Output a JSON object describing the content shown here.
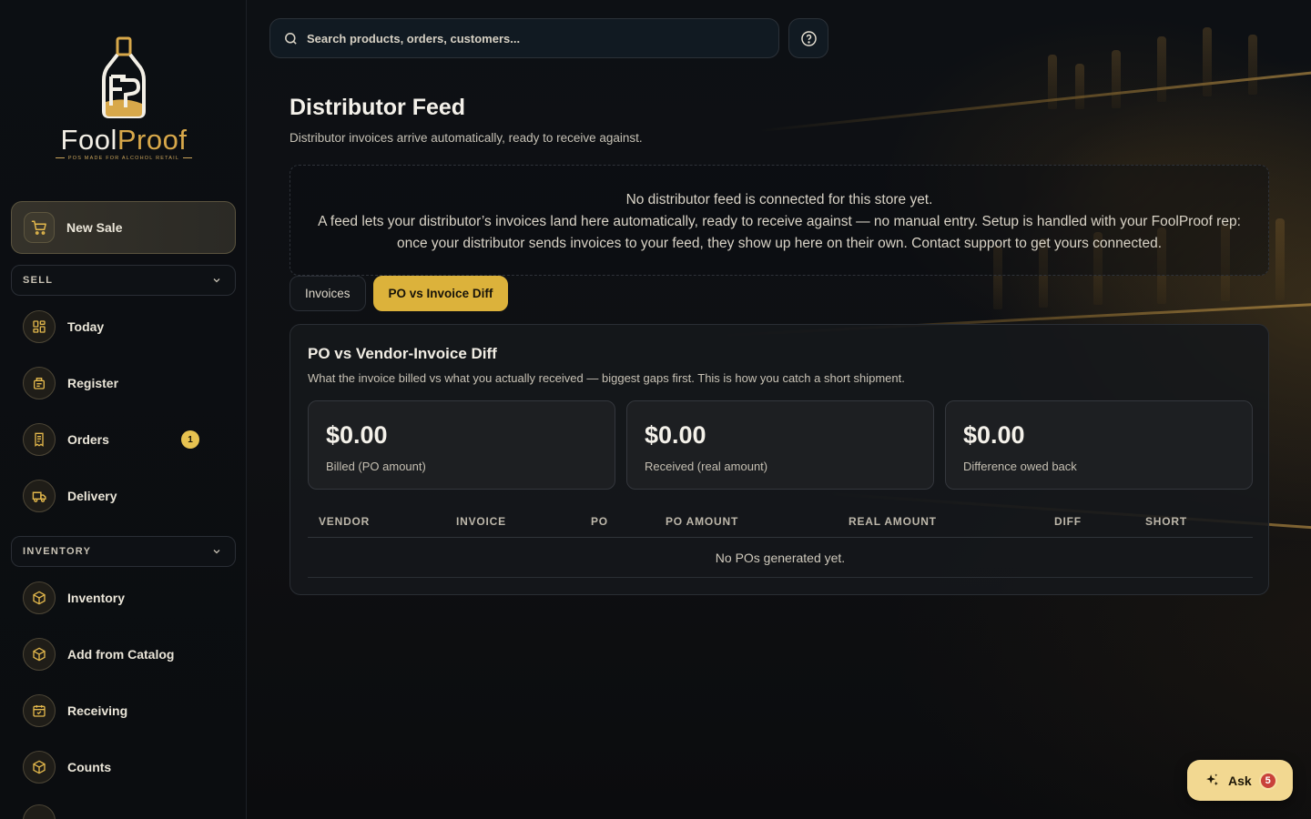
{
  "brand": {
    "name_part1": "Fool",
    "name_part2": "Proof",
    "tagline": "POS MADE FOR ALCOHOL RETAIL"
  },
  "sidebar": {
    "new_sale": "New Sale",
    "sections": [
      {
        "label": "SELL",
        "items": [
          {
            "label": "Today",
            "icon": "dashboard-icon"
          },
          {
            "label": "Register",
            "icon": "register-icon"
          },
          {
            "label": "Orders",
            "icon": "receipt-icon",
            "badge": "1"
          },
          {
            "label": "Delivery",
            "icon": "truck-icon"
          }
        ]
      },
      {
        "label": "INVENTORY",
        "items": [
          {
            "label": "Inventory",
            "icon": "box-icon"
          },
          {
            "label": "Add from Catalog",
            "icon": "box-icon"
          },
          {
            "label": "Receiving",
            "icon": "calendar-check-icon"
          },
          {
            "label": "Counts",
            "icon": "box-icon"
          }
        ]
      }
    ]
  },
  "search": {
    "placeholder": "Search products, orders, customers..."
  },
  "page": {
    "title": "Distributor Feed",
    "subtitle": "Distributor invoices arrive automatically, ready to receive against."
  },
  "notice": {
    "line1": "No distributor feed is connected for this store yet.",
    "line2": "A feed lets your distributor’s invoices land here automatically, ready to receive against — no manual entry. Setup is handled with your FoolProof rep: once your distributor sends invoices to your feed, they show up here on their own. Contact support to get yours connected."
  },
  "tabs": [
    {
      "label": "Invoices",
      "active": false
    },
    {
      "label": "PO vs Invoice Diff",
      "active": true
    }
  ],
  "diff_panel": {
    "title": "PO vs Vendor-Invoice Diff",
    "subtitle": "What the invoice billed vs what you actually received — biggest gaps first. This is how you catch a short shipment.",
    "stats": [
      {
        "value": "$0.00",
        "label": "Billed (PO amount)"
      },
      {
        "value": "$0.00",
        "label": "Received (real amount)"
      },
      {
        "value": "$0.00",
        "label": "Difference owed back"
      }
    ],
    "columns": [
      "VENDOR",
      "INVOICE",
      "PO",
      "PO AMOUNT",
      "REAL AMOUNT",
      "DIFF",
      "SHORT"
    ],
    "empty_text": "No POs generated yet."
  },
  "ask": {
    "label": "Ask",
    "badge": "5"
  },
  "colors": {
    "accent": "#dcb23b",
    "badge": "#e7c250",
    "ask_bg": "#f2d891",
    "ask_badge": "#c9413b"
  }
}
